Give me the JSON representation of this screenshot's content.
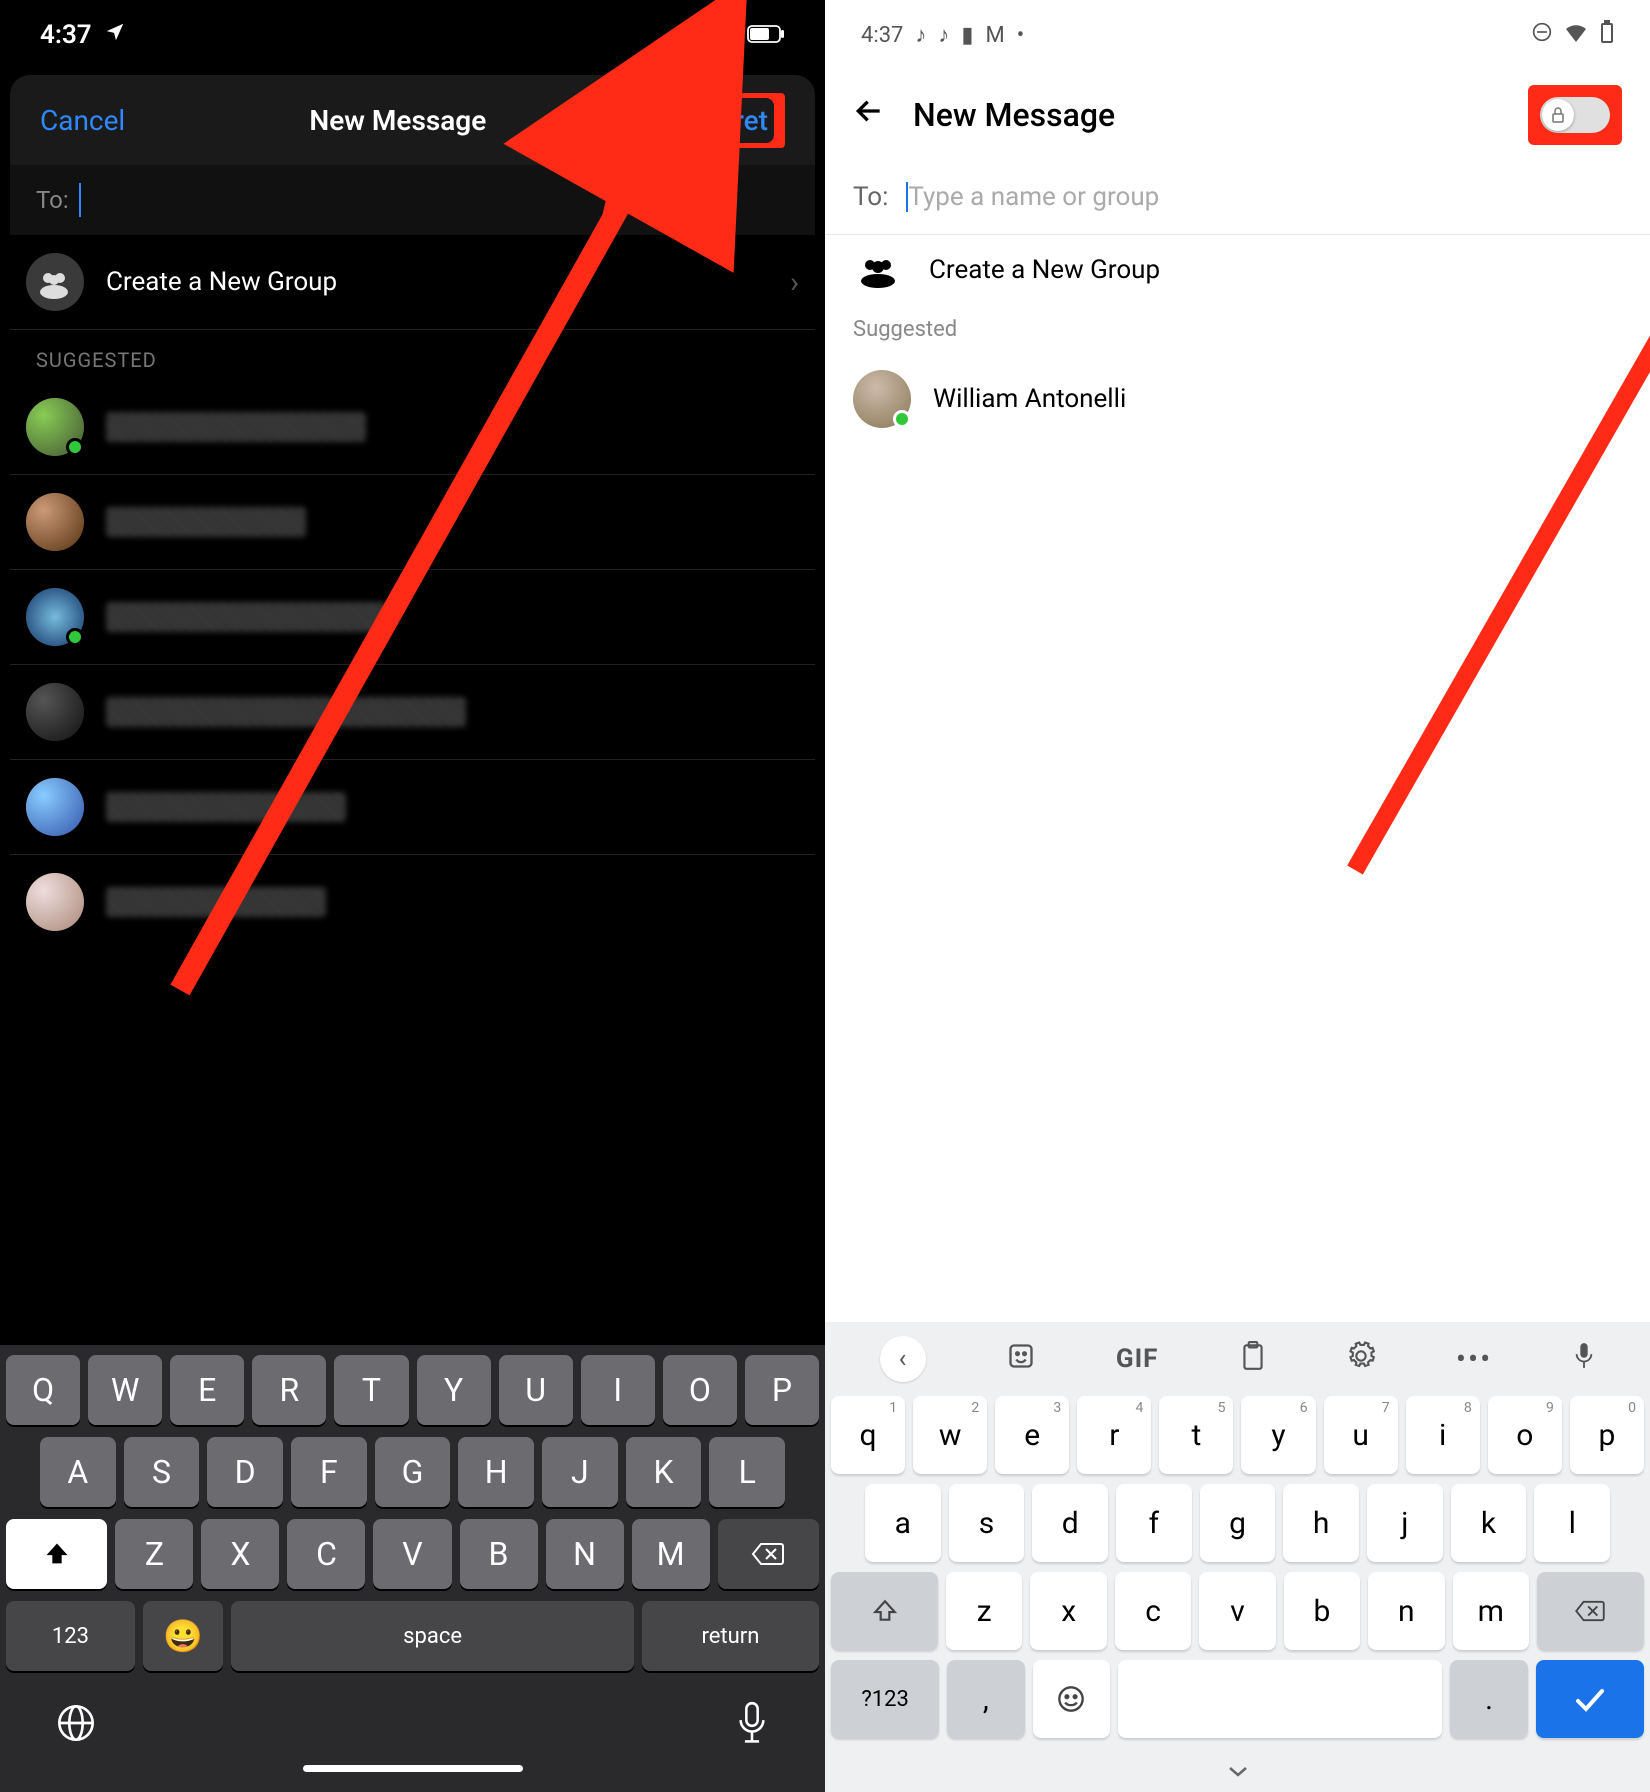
{
  "ios": {
    "status": {
      "time": "4:37",
      "loc_icon": "location-arrow",
      "signal": "signal-3",
      "wifi": "wifi",
      "battery": "battery-60"
    },
    "header": {
      "cancel": "Cancel",
      "title": "New Message",
      "secret": "Secret"
    },
    "to_label": "To:",
    "create_group": "Create a New Group",
    "suggested_label": "SUGGESTED",
    "suggested": [
      {
        "online": true
      },
      {
        "online": false
      },
      {
        "online": true
      },
      {
        "online": false
      },
      {
        "online": false
      },
      {
        "online": false
      }
    ],
    "keyboard": {
      "row1": [
        "Q",
        "W",
        "E",
        "R",
        "T",
        "Y",
        "U",
        "I",
        "O",
        "P"
      ],
      "row2": [
        "A",
        "S",
        "D",
        "F",
        "G",
        "H",
        "J",
        "K",
        "L"
      ],
      "row3": [
        "Z",
        "X",
        "C",
        "V",
        "B",
        "N",
        "M"
      ],
      "numkey": "123",
      "space": "space",
      "return": "return"
    }
  },
  "android": {
    "status": {
      "time": "4:37"
    },
    "header": {
      "title": "New Message"
    },
    "to_label": "To:",
    "to_placeholder": "Type a name or group",
    "create_group": "Create a New Group",
    "suggested_label": "Suggested",
    "suggested": [
      {
        "name": "William Antonelli",
        "online": true
      }
    ],
    "keyboard": {
      "gif": "GIF",
      "row1": [
        {
          "k": "q",
          "n": "1"
        },
        {
          "k": "w",
          "n": "2"
        },
        {
          "k": "e",
          "n": "3"
        },
        {
          "k": "r",
          "n": "4"
        },
        {
          "k": "t",
          "n": "5"
        },
        {
          "k": "y",
          "n": "6"
        },
        {
          "k": "u",
          "n": "7"
        },
        {
          "k": "i",
          "n": "8"
        },
        {
          "k": "o",
          "n": "9"
        },
        {
          "k": "p",
          "n": "0"
        }
      ],
      "row2": [
        "a",
        "s",
        "d",
        "f",
        "g",
        "h",
        "j",
        "k",
        "l"
      ],
      "row3": [
        "z",
        "x",
        "c",
        "v",
        "b",
        "n",
        "m"
      ],
      "symkey": "?123",
      "comma": ",",
      "period": "."
    }
  }
}
